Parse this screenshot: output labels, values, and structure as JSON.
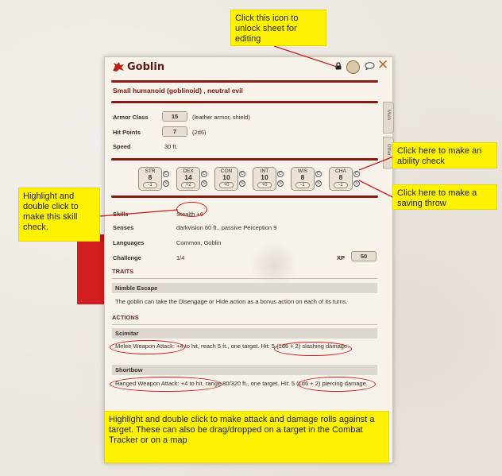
{
  "callouts": {
    "unlock": "Click this icon to unlock sheet for editing",
    "ability_check": "Click here to make an ability check",
    "skill_check": "Highlight and double click to make this skill check.",
    "saving_throw": "Click here to make a saving throw",
    "attack_rolls": "Highlight and double click to make attack and damage rolls against a target. These can also be drag/dropped on a target in the Combat Tracker or on a map"
  },
  "sheet": {
    "title": "Goblin",
    "subtitle": "Small humanoid (goblinoid) , neutral evil",
    "close_glyph": "✕",
    "icons": [
      "lock-icon",
      "portrait-icon",
      "chat-icon"
    ],
    "tabs": [
      "Main",
      "Other"
    ],
    "stats": {
      "armor_class_label": "Armor Class",
      "armor_class": "15",
      "armor_note": "(leather armor, shield)",
      "hit_points_label": "Hit Points",
      "hit_points": "7",
      "hp_note": "(2d6)",
      "speed_label": "Speed",
      "speed": "30 ft."
    },
    "abilities": [
      {
        "name": "STR",
        "score": "8",
        "mod": "-1"
      },
      {
        "name": "DEX",
        "score": "14",
        "mod": "+2"
      },
      {
        "name": "CON",
        "score": "10",
        "mod": "+0"
      },
      {
        "name": "INT",
        "score": "10",
        "mod": "+0"
      },
      {
        "name": "WIS",
        "score": "8",
        "mod": "-1"
      },
      {
        "name": "CHA",
        "score": "8",
        "mod": "-1"
      }
    ],
    "check_glyph": "C",
    "save_glyph": "S",
    "details": {
      "skills_label": "Skills",
      "skills": "Stealth +6",
      "senses_label": "Senses",
      "senses": "darkvision 60 ft., passive Perception 9",
      "languages_label": "Languages",
      "languages": "Common, Goblin",
      "challenge_label": "Challenge",
      "challenge": "1/4",
      "xp_label": "XP",
      "xp": "50"
    },
    "traits_header": "TRAITS",
    "trait_name": "Nimble Escape",
    "trait_text": "The goblin can take the Disengage or Hide action as a bonus action on each of its turns.",
    "actions_header": "ACTIONS",
    "action1_name": "Scimitar",
    "action1_text": "Melee Weapon Attack: +4 to hit, reach 5 ft., one target. Hit: 5 (1d6 + 2) slashing damage.",
    "action2_name": "Shortbow",
    "action2_text": "Ranged Weapon Attack: +4 to hit, range 80/320 ft., one target. Hit: 5 (1d6 + 2) piercing damage."
  },
  "colors": {
    "accent": "#8a1b10",
    "callout_bg": "#fff200",
    "annotation_red": "#cc1f1f"
  }
}
